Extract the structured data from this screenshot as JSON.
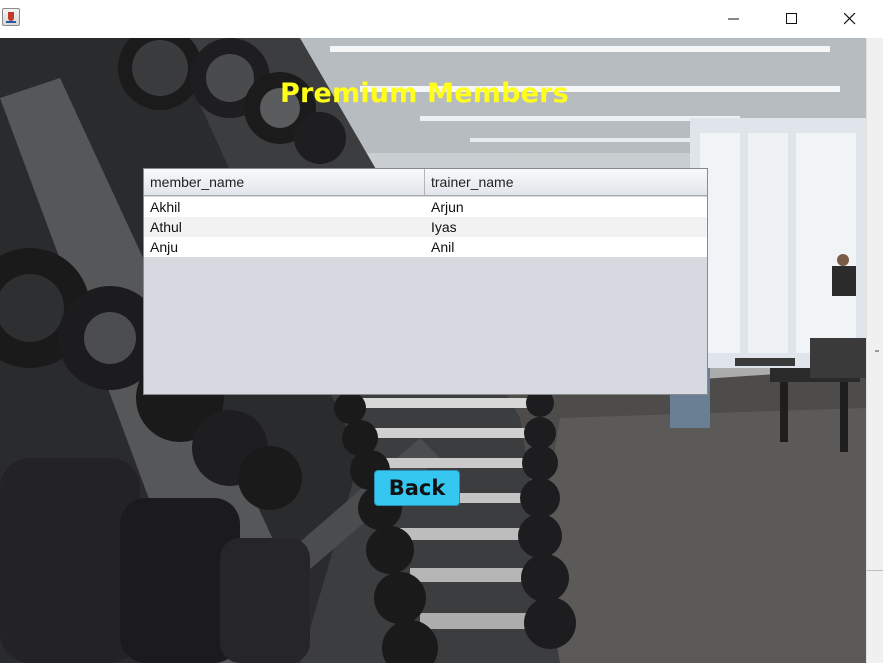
{
  "window": {
    "title": "",
    "controls": {
      "minimize_icon": "minimize-icon",
      "maximize_icon": "maximize-icon",
      "close_icon": "close-icon"
    }
  },
  "page": {
    "heading": "Premium Members",
    "heading_color": "#ffff1a"
  },
  "table": {
    "columns": [
      "member_name",
      "trainer_name"
    ],
    "rows": [
      [
        "Akhil",
        "Arjun"
      ],
      [
        "Athul",
        "Iyas"
      ],
      [
        "Anju",
        "Anil"
      ]
    ]
  },
  "actions": {
    "back_label": "Back",
    "back_color": "#35c7f0"
  }
}
